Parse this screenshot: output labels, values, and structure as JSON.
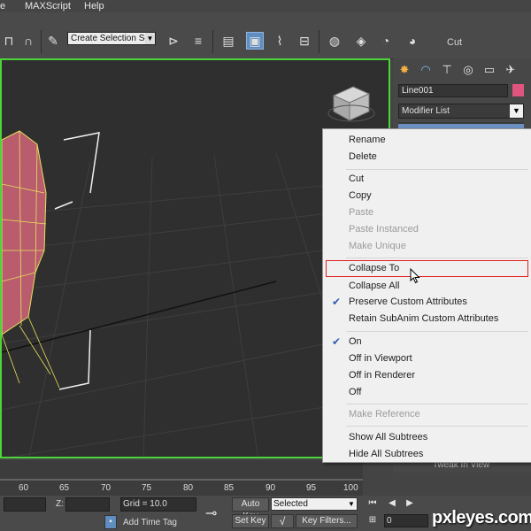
{
  "menubar": {
    "items": [
      {
        "label": "e"
      },
      {
        "label": "MAXScript"
      },
      {
        "label": "Help"
      }
    ]
  },
  "toolbar": {
    "selection_set": "Create Selection Se",
    "cut_label": "Cut"
  },
  "command_panel": {
    "object_name": "Line001",
    "object_color": "#e05580",
    "modifier_list": "Modifier List",
    "tweak_button": "Tweak In View"
  },
  "context_menu": {
    "items": [
      {
        "label": "Rename",
        "enabled": true
      },
      {
        "label": "Delete",
        "enabled": true
      },
      {
        "label": "Cut",
        "enabled": true
      },
      {
        "label": "Copy",
        "enabled": true
      },
      {
        "label": "Paste",
        "enabled": false
      },
      {
        "label": "Paste Instanced",
        "enabled": false
      },
      {
        "label": "Make Unique",
        "enabled": false
      },
      {
        "label": "Collapse To",
        "enabled": true,
        "highlighted": true
      },
      {
        "label": "Collapse All",
        "enabled": true
      },
      {
        "label": "Preserve Custom Attributes",
        "enabled": true,
        "checked": true
      },
      {
        "label": "Retain SubAnim Custom Attributes",
        "enabled": true
      },
      {
        "label": "On",
        "enabled": true,
        "checked": true
      },
      {
        "label": "Off in Viewport",
        "enabled": true
      },
      {
        "label": "Off in Renderer",
        "enabled": true
      },
      {
        "label": "Off",
        "enabled": true
      },
      {
        "label": "Make Reference",
        "enabled": false
      },
      {
        "label": "Show All Subtrees",
        "enabled": true
      },
      {
        "label": "Hide All Subtrees",
        "enabled": true
      }
    ],
    "highlight_color": "#e02020",
    "check_color": "#2a5fb0"
  },
  "timeline": {
    "ticks": [
      "60",
      "65",
      "70",
      "75",
      "80",
      "85",
      "90",
      "95",
      "100"
    ]
  },
  "statusbar": {
    "z_label": "Z:",
    "grid": "Grid = 10.0",
    "auto_key": "Auto Key",
    "set_key": "Set Key",
    "selected": "Selected",
    "key_filters": "Key Filters...",
    "add_time_tag": "Add Time Tag",
    "frame": "0"
  },
  "watermark": "pxleyes.com",
  "colors": {
    "viewport_border": "#4cd43a",
    "mesh_fill": "#b95c6e",
    "mesh_edge": "#e8e25a"
  }
}
